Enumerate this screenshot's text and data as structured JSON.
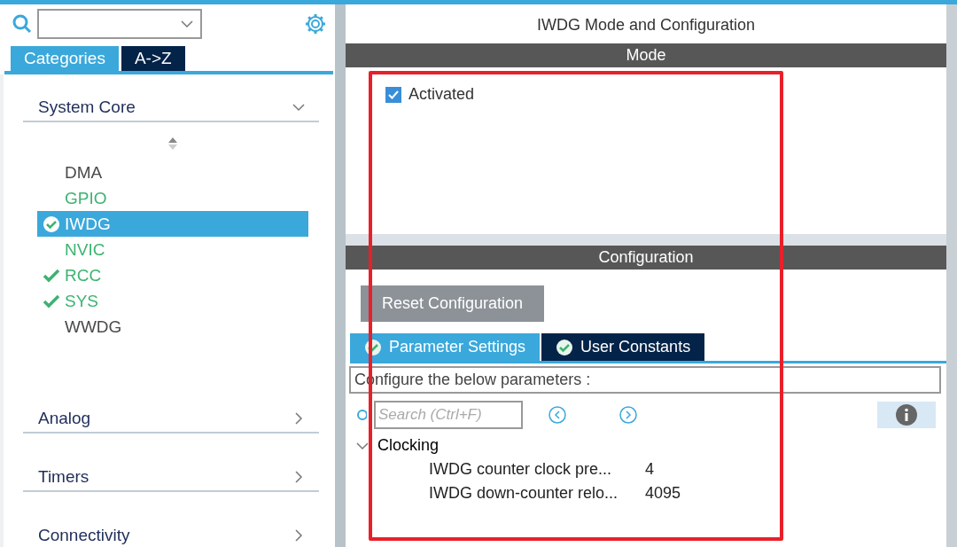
{
  "sidebar": {
    "tabs": [
      {
        "label": "Categories",
        "selected": true
      },
      {
        "label": "A->Z",
        "selected": false
      }
    ],
    "categories": [
      {
        "label": "System Core",
        "expanded": true,
        "items": [
          {
            "name": "DMA",
            "configured": false,
            "checked": false,
            "selected": false
          },
          {
            "name": "GPIO",
            "configured": true,
            "checked": false,
            "selected": false
          },
          {
            "name": "IWDG",
            "configured": true,
            "checked": true,
            "selected": true
          },
          {
            "name": "NVIC",
            "configured": true,
            "checked": false,
            "selected": false
          },
          {
            "name": "RCC",
            "configured": true,
            "checked": true,
            "selected": false
          },
          {
            "name": "SYS",
            "configured": true,
            "checked": true,
            "selected": false
          },
          {
            "name": "WWDG",
            "configured": false,
            "checked": false,
            "selected": false
          }
        ]
      },
      {
        "label": "Analog",
        "expanded": false
      },
      {
        "label": "Timers",
        "expanded": false
      },
      {
        "label": "Connectivity",
        "expanded": false
      }
    ]
  },
  "main": {
    "title": "IWDG Mode and Configuration",
    "mode": {
      "header": "Mode",
      "activated": {
        "label": "Activated",
        "checked": true
      }
    },
    "configuration": {
      "header": "Configuration",
      "reset_button": "Reset Configuration",
      "tabs": [
        {
          "label": "Parameter Settings",
          "selected": true
        },
        {
          "label": "User Constants",
          "selected": false
        }
      ],
      "hint": "Configure the below parameters :",
      "search": {
        "placeholder": "Search (Ctrl+F)"
      },
      "groups": [
        {
          "label": "Clocking",
          "expanded": true,
          "params": [
            {
              "name": "IWDG counter clock pre...",
              "value": "4"
            },
            {
              "name": "IWDG down-counter relo...",
              "value": "4095"
            }
          ]
        }
      ]
    }
  },
  "annotation": {
    "kind": "rectangle",
    "color": "#e8202a"
  }
}
